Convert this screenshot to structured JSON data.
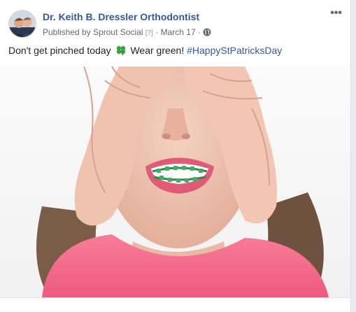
{
  "post": {
    "page_name": "Dr. Keith B. Dressler Orthodontist",
    "published_by_prefix": "Published by",
    "published_app": "Sprout Social",
    "help_marker": "[?]",
    "date": "March 17",
    "separator": "·",
    "privacy_icon": "globe-icon",
    "more_icon": "more-options-icon",
    "more_label": "•••",
    "text_before": "Don't get pinched today",
    "emoji": "four-leaf-clover-icon",
    "text_after": "Wear green!",
    "hashtag": "#HappyStPatricksDay",
    "photo_icon": "girl-covering-eyes-with-braces-photo"
  },
  "colors": {
    "link": "#365899",
    "text": "#1d2129",
    "meta": "#616770",
    "shirt": "#f56b8c",
    "braces": "#3fa05a"
  }
}
